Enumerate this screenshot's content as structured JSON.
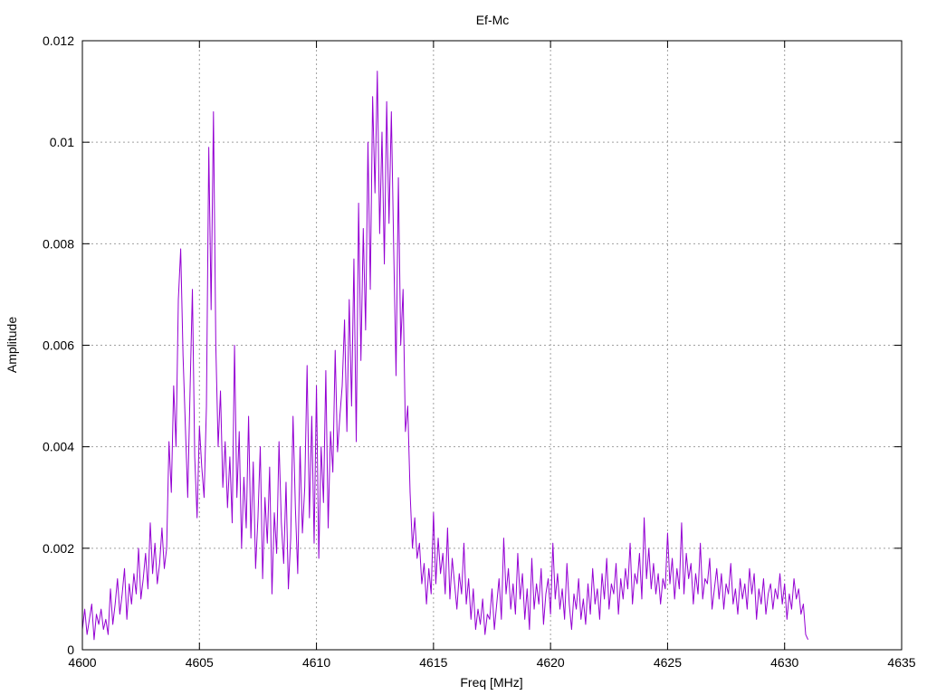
{
  "chart_data": {
    "type": "line",
    "title": "Ef-Mc",
    "xlabel": "Freq [MHz]",
    "ylabel": "Amplitude",
    "xlim": [
      4600,
      4635
    ],
    "ylim": [
      0,
      0.012
    ],
    "x_ticks": [
      4600,
      4605,
      4610,
      4615,
      4620,
      4625,
      4630,
      4635
    ],
    "y_ticks": [
      0,
      0.002,
      0.004,
      0.006,
      0.008,
      0.01,
      0.012
    ],
    "x_tick_labels": [
      "4600",
      "4605",
      "4610",
      "4615",
      "4620",
      "4625",
      "4630",
      "4635"
    ],
    "y_tick_labels": [
      "0",
      "0.002",
      "0.004",
      "0.006",
      "0.008",
      "0.01",
      "0.012"
    ],
    "grid": true,
    "series": [
      {
        "color": "#9400d3",
        "x_start": 4600,
        "x_end": 4632,
        "x_step": 0.1,
        "values": [
          0.0004,
          0.0008,
          0.0003,
          0.0006,
          0.0009,
          0.0002,
          0.0007,
          0.0005,
          0.0008,
          0.0004,
          0.0006,
          0.0003,
          0.0012,
          0.0005,
          0.0009,
          0.0014,
          0.0007,
          0.0011,
          0.0016,
          0.0006,
          0.0013,
          0.0009,
          0.0015,
          0.0011,
          0.002,
          0.001,
          0.0014,
          0.0019,
          0.0012,
          0.0025,
          0.0015,
          0.0021,
          0.0013,
          0.0017,
          0.0024,
          0.0016,
          0.002,
          0.0041,
          0.0031,
          0.0052,
          0.004,
          0.0069,
          0.0079,
          0.0058,
          0.0044,
          0.003,
          0.0051,
          0.0071,
          0.0038,
          0.0026,
          0.0044,
          0.0036,
          0.003,
          0.0048,
          0.0099,
          0.0067,
          0.0106,
          0.006,
          0.004,
          0.0051,
          0.0032,
          0.0041,
          0.0028,
          0.0038,
          0.0025,
          0.006,
          0.003,
          0.0043,
          0.002,
          0.0034,
          0.0024,
          0.0046,
          0.0022,
          0.0037,
          0.0016,
          0.0026,
          0.004,
          0.0014,
          0.003,
          0.0021,
          0.0036,
          0.0011,
          0.0027,
          0.0019,
          0.0041,
          0.0025,
          0.0017,
          0.0033,
          0.0012,
          0.0022,
          0.0046,
          0.0028,
          0.0015,
          0.004,
          0.0023,
          0.0032,
          0.0056,
          0.0026,
          0.0046,
          0.0021,
          0.0052,
          0.0018,
          0.004,
          0.0029,
          0.0055,
          0.0024,
          0.0043,
          0.0035,
          0.0059,
          0.0039,
          0.0046,
          0.0052,
          0.0065,
          0.0043,
          0.0069,
          0.0048,
          0.0077,
          0.0041,
          0.0088,
          0.0057,
          0.0083,
          0.0063,
          0.01,
          0.0071,
          0.0109,
          0.009,
          0.0114,
          0.0082,
          0.0102,
          0.0076,
          0.0108,
          0.0084,
          0.0106,
          0.0079,
          0.0054,
          0.0093,
          0.006,
          0.0071,
          0.0043,
          0.0048,
          0.0031,
          0.002,
          0.0026,
          0.0018,
          0.0021,
          0.0013,
          0.0017,
          0.0009,
          0.0016,
          0.0011,
          0.0027,
          0.0013,
          0.0022,
          0.0015,
          0.0019,
          0.0011,
          0.0024,
          0.001,
          0.0018,
          0.0013,
          0.0008,
          0.0015,
          0.0011,
          0.0021,
          0.0009,
          0.0014,
          0.0006,
          0.0012,
          0.0004,
          0.0008,
          0.0005,
          0.001,
          0.0003,
          0.0007,
          0.0006,
          0.0012,
          0.0004,
          0.0009,
          0.0014,
          0.0006,
          0.0022,
          0.0011,
          0.0016,
          0.0008,
          0.0013,
          0.0007,
          0.0019,
          0.001,
          0.0015,
          0.0006,
          0.0012,
          0.0004,
          0.0018,
          0.0008,
          0.0013,
          0.0009,
          0.0016,
          0.0005,
          0.0011,
          0.0014,
          0.0007,
          0.0021,
          0.001,
          0.0015,
          0.0008,
          0.0012,
          0.0006,
          0.0017,
          0.0009,
          0.0004,
          0.0011,
          0.0008,
          0.0014,
          0.0006,
          0.001,
          0.0005,
          0.0013,
          0.0007,
          0.0016,
          0.0009,
          0.0012,
          0.0006,
          0.0015,
          0.001,
          0.0018,
          0.0008,
          0.0013,
          0.0011,
          0.0017,
          0.0007,
          0.0014,
          0.001,
          0.0016,
          0.0012,
          0.0021,
          0.0009,
          0.0015,
          0.0013,
          0.0019,
          0.001,
          0.0026,
          0.0014,
          0.002,
          0.0012,
          0.0017,
          0.0011,
          0.0015,
          0.0009,
          0.0014,
          0.0012,
          0.0023,
          0.0013,
          0.0018,
          0.001,
          0.0016,
          0.0012,
          0.0025,
          0.0011,
          0.0019,
          0.0014,
          0.0017,
          0.0009,
          0.0015,
          0.0011,
          0.0021,
          0.001,
          0.0014,
          0.0013,
          0.0018,
          0.0008,
          0.0012,
          0.0016,
          0.001,
          0.0015,
          0.0008,
          0.0013,
          0.0011,
          0.0017,
          0.0009,
          0.0012,
          0.0007,
          0.0014,
          0.001,
          0.0013,
          0.0008,
          0.0016,
          0.0011,
          0.0015,
          0.0006,
          0.0012,
          0.0009,
          0.0014,
          0.0007,
          0.0011,
          0.0013,
          0.0008,
          0.0012,
          0.001,
          0.0015,
          0.0009,
          0.0013,
          0.0006,
          0.0011,
          0.0008,
          0.0014,
          0.001,
          0.0012,
          0.0007,
          0.0009,
          0.0003,
          0.0002
        ]
      }
    ]
  }
}
